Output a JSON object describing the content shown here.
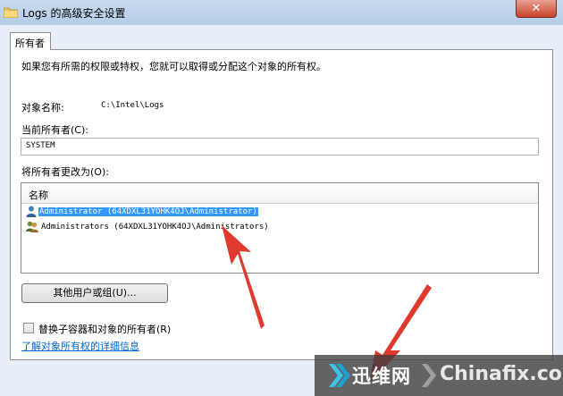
{
  "window": {
    "title": "Logs 的高级安全设置",
    "close_label": "✕"
  },
  "tabs": [
    {
      "label": "所有者"
    }
  ],
  "panel": {
    "intro": "如果您有所需的权限或特权，您就可以取得或分配这个对象的所有权。",
    "object_name_label": "对象名称:",
    "object_name_value": "C:\\Intel\\Logs",
    "current_owner_label": "当前所有者(C):",
    "current_owner_value": "SYSTEM",
    "change_owner_label": "将所有者更改为(O):",
    "list": {
      "header": "名称",
      "rows": [
        {
          "label": "Administrator (64XDXL31YOHK4OJ\\Administrator)",
          "selected": true,
          "icon": "user-icon"
        },
        {
          "label": "Administrators (64XDXL31YOHK4OJ\\Administrators)",
          "selected": false,
          "icon": "group-icon"
        }
      ]
    },
    "other_users_button": "其他用户或组(U)...",
    "replace_checkbox_label": "替换子容器和对象的所有者(R)",
    "replace_checked": false,
    "learn_more_link": "了解对象所有权的详细信息"
  },
  "watermark": {
    "cn": "迅维网",
    "en": "Chinafix.com"
  },
  "colors": {
    "selection": "#3399ff",
    "arrow": "#e03a2e",
    "link": "#0066cc"
  }
}
